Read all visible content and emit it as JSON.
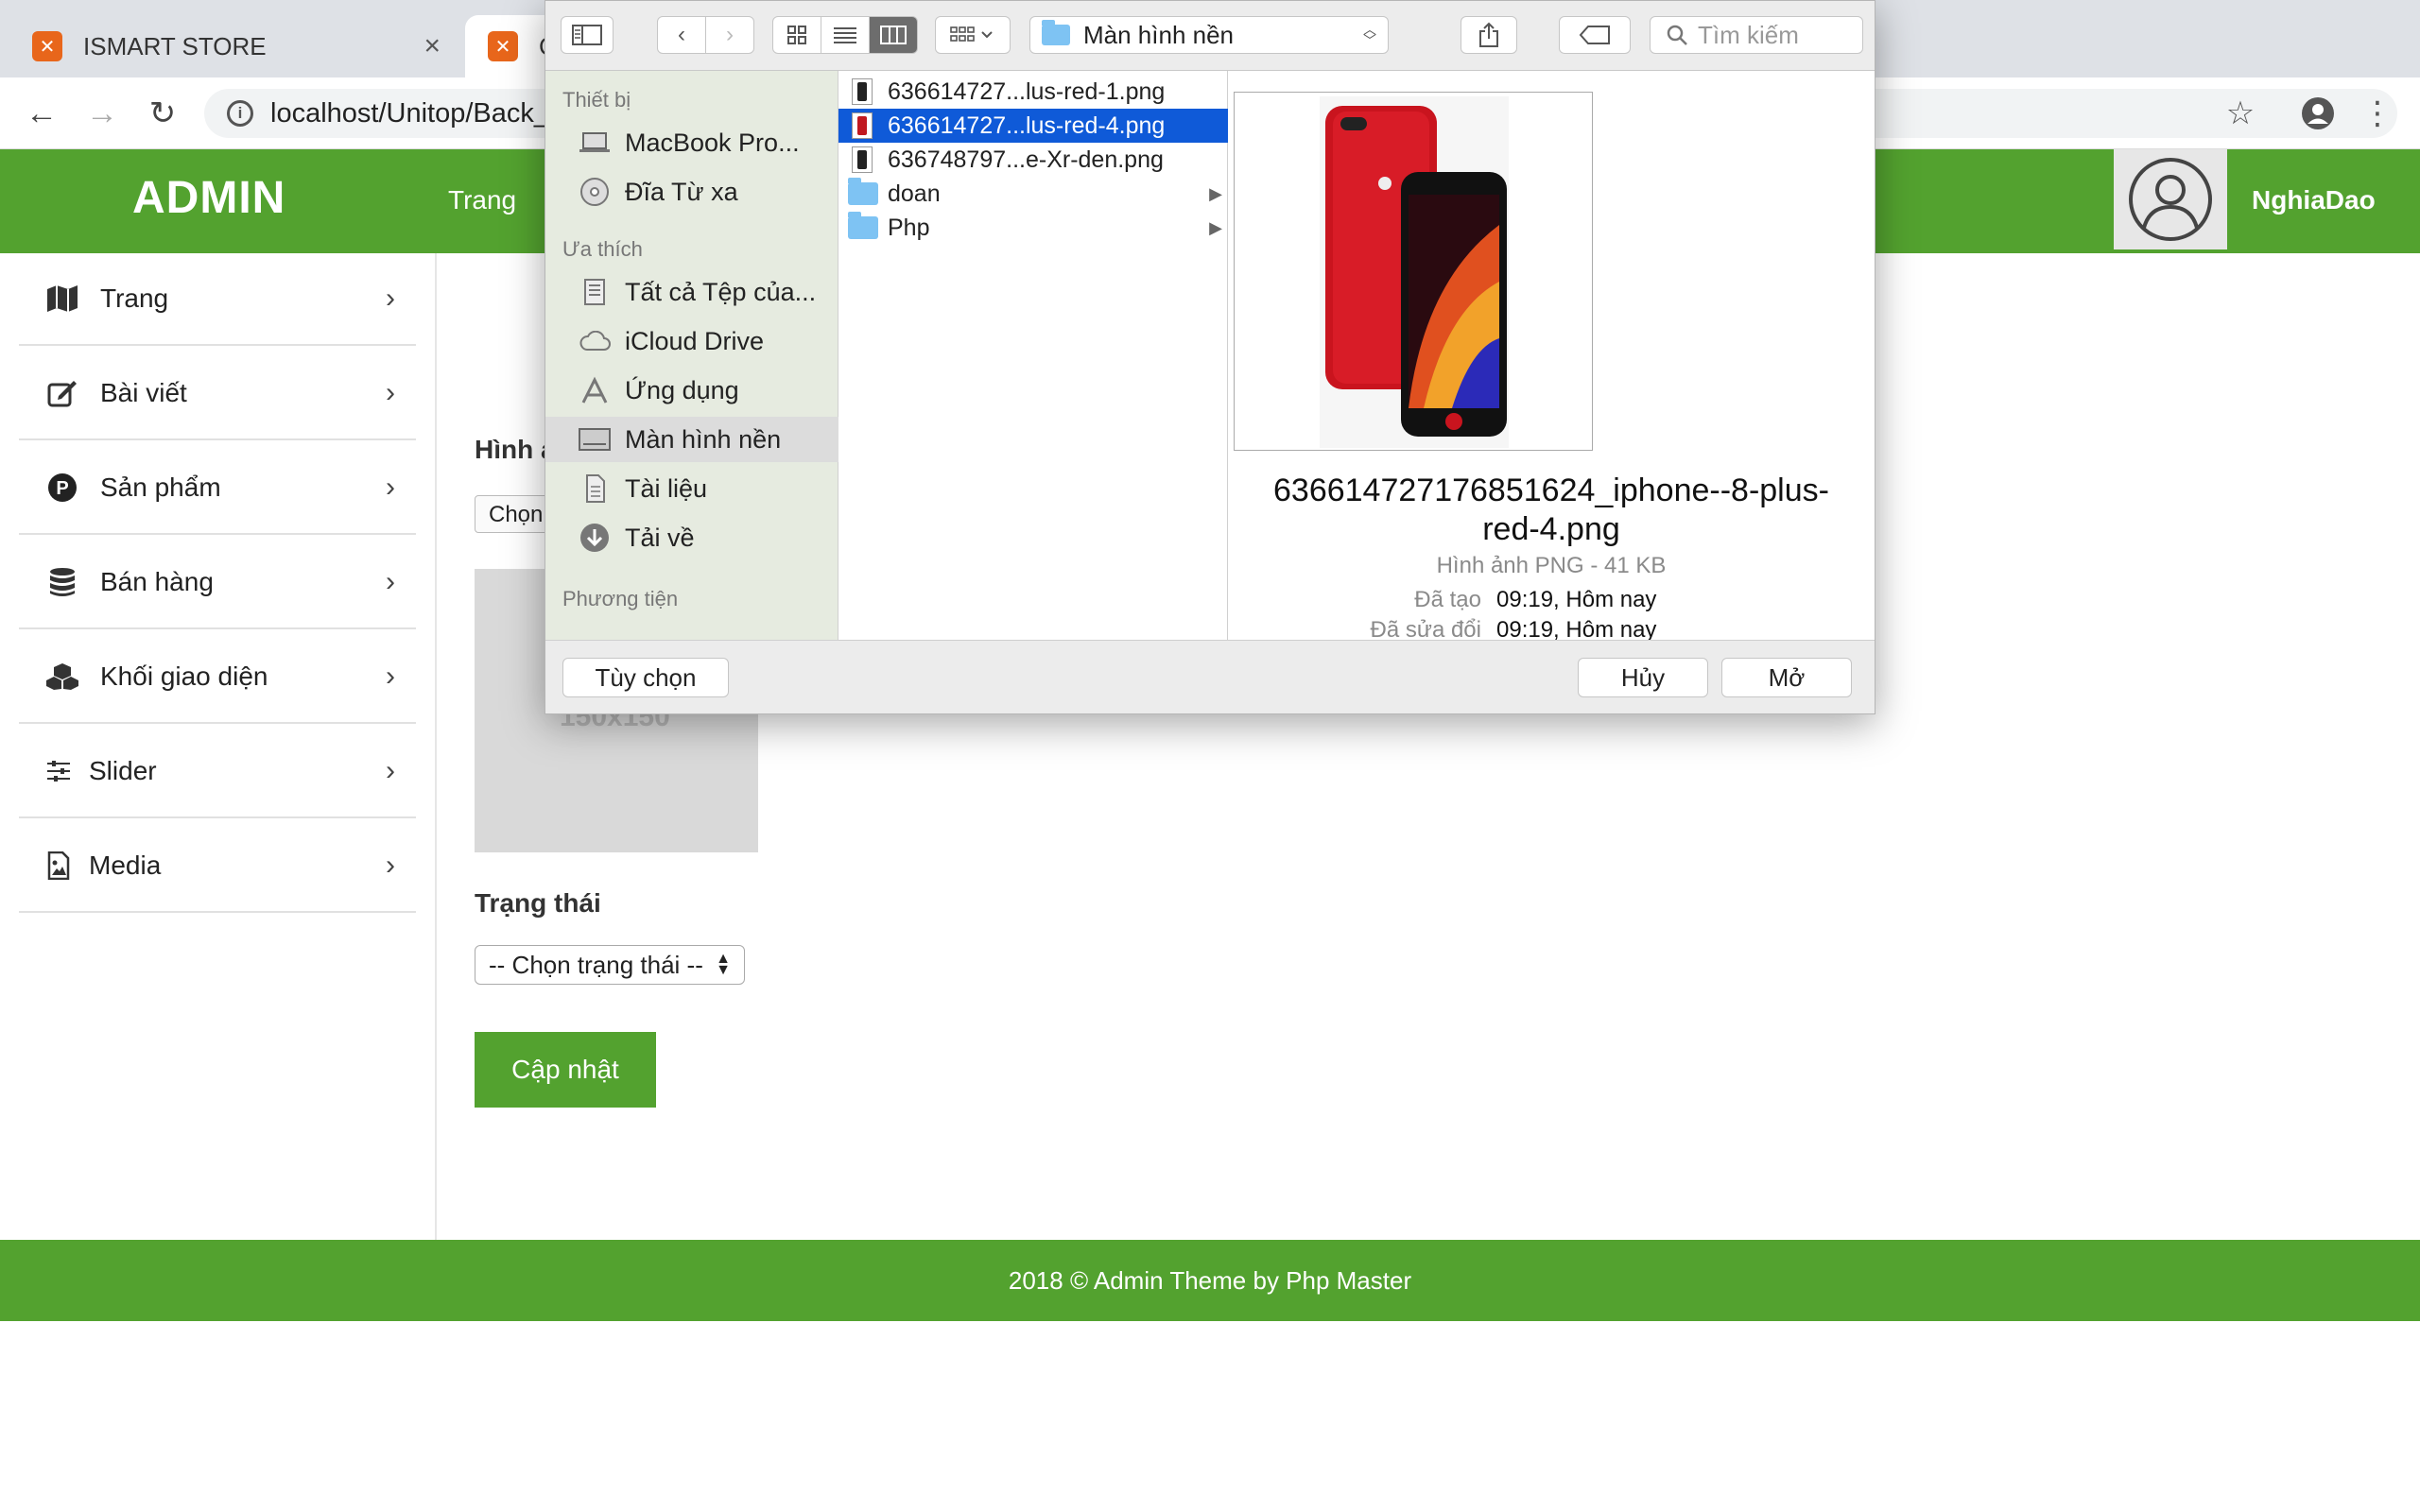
{
  "browser": {
    "tabs": [
      {
        "title": "ISMART STORE",
        "close": "×"
      },
      {
        "title": "C"
      }
    ],
    "url": "localhost/Unitop/Back_"
  },
  "admin": {
    "brand": "ADMIN",
    "nav_first": "Trang",
    "username": "NghiaDao"
  },
  "sidebar": {
    "items": [
      {
        "label": "Trang",
        "icon": "map-icon"
      },
      {
        "label": "Bài viết",
        "icon": "edit-icon"
      },
      {
        "label": "Sản phẩm",
        "icon": "product-p-icon"
      },
      {
        "label": "Bán hàng",
        "icon": "database-icon"
      },
      {
        "label": "Khối giao diện",
        "icon": "cubes-icon"
      },
      {
        "label": "Slider",
        "icon": "sliders-icon"
      },
      {
        "label": "Media",
        "icon": "image-file-icon"
      }
    ]
  },
  "form": {
    "image_label": "Hình ả",
    "file_button": "Chọn",
    "thumb_placeholder": "150x150",
    "status_label": "Trạng thái",
    "status_select": "-- Chọn trạng thái --",
    "submit": "Cập nhật"
  },
  "footer": {
    "text": "2018 © Admin Theme by Php Master"
  },
  "dialog": {
    "location": "Màn hình nền",
    "search_placeholder": "Tìm kiếm",
    "sidebar_sections": [
      {
        "heading": "Thiết bị",
        "items": [
          "MacBook Pro...",
          "Đĩa Từ xa"
        ]
      },
      {
        "heading": "Ưa thích",
        "items": [
          "Tất cả Tệp của...",
          "iCloud Drive",
          "Ứng dụng",
          "Màn hình nền",
          "Tài liệu",
          "Tải về"
        ]
      },
      {
        "heading": "Phương tiện",
        "items": []
      }
    ],
    "files": [
      {
        "name": "636614727...lus-red-1.png",
        "type": "file",
        "selected": false
      },
      {
        "name": "636614727...lus-red-4.png",
        "type": "file",
        "selected": true
      },
      {
        "name": "636748797...e-Xr-den.png",
        "type": "file",
        "selected": false
      },
      {
        "name": "doan",
        "type": "folder",
        "selected": false
      },
      {
        "name": "Php",
        "type": "folder",
        "selected": false
      }
    ],
    "preview": {
      "name_line1": "636614727176851624_iphone--8-plus-",
      "name_line2": "red-4.png",
      "meta": "Hình ảnh PNG - 41 KB",
      "created_key": "Đã tạo",
      "created_val": "09:19, Hôm nay",
      "modified_key": "Đã sửa đổi",
      "modified_val": "09:19, Hôm nay"
    },
    "buttons": {
      "options": "Tùy chọn",
      "cancel": "Hủy",
      "open": "Mở"
    },
    "selected_color": "#0f5ad8"
  },
  "colors": {
    "brand_green": "#53a22f"
  }
}
